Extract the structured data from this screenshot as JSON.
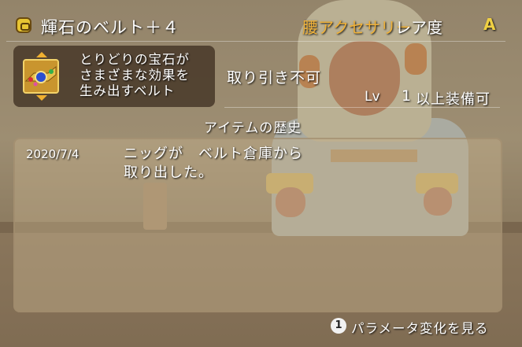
{
  "header": {
    "icon": "item-bag-icon",
    "item_name": "輝石のベルト＋４",
    "category": "腰アクセサリー",
    "rarity_label": "レア度",
    "rarity_value": "A"
  },
  "description": {
    "icon": "belt-gem-icon",
    "lines": [
      "とりどりの宝石が",
      "さまざまな効果を",
      "生み出すベルト"
    ]
  },
  "trade_status": "取り引き不可",
  "level": {
    "label": "Lv",
    "value": "1",
    "suffix": "以上装備可"
  },
  "history": {
    "title": "アイテムの歴史",
    "entries": [
      {
        "date": "2020/7/4",
        "lines": [
          "ニッグが　ベルト倉庫から",
          "取り出した。"
        ]
      }
    ]
  },
  "footer": {
    "button_glyph": "1",
    "label": "パラメータ変化を見る"
  },
  "colors": {
    "category": "#f0b23a",
    "rarity_value": "#f0d043",
    "text": "#ffffff"
  }
}
